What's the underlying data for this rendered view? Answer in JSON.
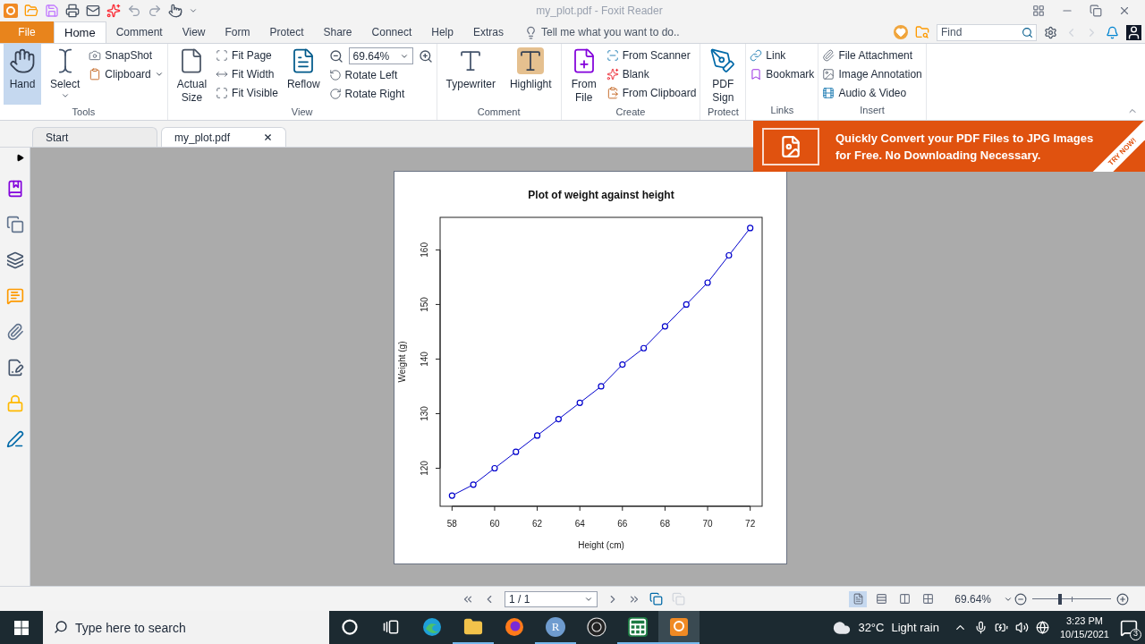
{
  "title_bar": {
    "title": "my_plot.pdf - Foxit Reader"
  },
  "ribbon_tabs": [
    {
      "label": "File",
      "kind": "file",
      "selected": false
    },
    {
      "label": "Home",
      "kind": "tab",
      "selected": true
    },
    {
      "label": "Comment",
      "kind": "tab",
      "selected": false
    },
    {
      "label": "View",
      "kind": "tab",
      "selected": false
    },
    {
      "label": "Form",
      "kind": "tab",
      "selected": false
    },
    {
      "label": "Protect",
      "kind": "tab",
      "selected": false
    },
    {
      "label": "Share",
      "kind": "tab",
      "selected": false
    },
    {
      "label": "Connect",
      "kind": "tab",
      "selected": false
    },
    {
      "label": "Help",
      "kind": "tab",
      "selected": false
    },
    {
      "label": "Extras",
      "kind": "tab",
      "selected": false
    }
  ],
  "tell_me": {
    "placeholder": "Tell me what you want to do.."
  },
  "find": {
    "placeholder": "Find"
  },
  "ribbon_groups": [
    {
      "label": "Tools",
      "columns": [
        {
          "kind": "large",
          "label": "Hand",
          "selected": true,
          "dropdown": false
        },
        {
          "kind": "large",
          "label": "Select",
          "selected": false,
          "dropdown": true
        },
        {
          "kind": "stack",
          "items": [
            {
              "kind": "small",
              "label": "SnapShot",
              "dropdown": false
            },
            {
              "kind": "small",
              "label": "Clipboard",
              "dropdown": true
            }
          ]
        }
      ]
    },
    {
      "label": "View",
      "columns": [
        {
          "kind": "large",
          "label": "Actual Size",
          "selected": false
        },
        {
          "kind": "stack",
          "items": [
            {
              "kind": "small",
              "label": "Fit Page",
              "dropdown": false
            },
            {
              "kind": "small",
              "label": "Fit Width",
              "dropdown": false
            },
            {
              "kind": "small",
              "label": "Fit Visible",
              "dropdown": false
            }
          ]
        },
        {
          "kind": "large",
          "label": "Reflow",
          "selected": false,
          "dropdown": false
        },
        {
          "kind": "stack",
          "items": [
            {
              "kind": "zoom",
              "value": "69.64%"
            },
            {
              "kind": "small",
              "label": "Rotate Left",
              "dropdown": false
            },
            {
              "kind": "small",
              "label": "Rotate Right",
              "dropdown": false
            }
          ]
        }
      ]
    },
    {
      "label": "Comment",
      "columns": [
        {
          "kind": "large",
          "label": "Typewriter",
          "selected": false,
          "dropdown": false
        },
        {
          "kind": "large",
          "label": "Highlight",
          "selected": false,
          "dropdown": false
        }
      ]
    },
    {
      "label": "Create",
      "columns": [
        {
          "kind": "large",
          "label": "From File",
          "selected": false
        },
        {
          "kind": "stack",
          "items": [
            {
              "kind": "small",
              "label": "From Scanner",
              "dropdown": false
            },
            {
              "kind": "small",
              "label": "Blank",
              "dropdown": false
            },
            {
              "kind": "small",
              "label": "From Clipboard",
              "dropdown": false
            }
          ]
        }
      ]
    },
    {
      "label": "Protect",
      "columns": [
        {
          "kind": "large",
          "label": "PDF Sign",
          "selected": false
        }
      ]
    },
    {
      "label": "Links",
      "columns": [
        {
          "kind": "stack",
          "items": [
            {
              "kind": "small",
              "label": "Link",
              "dropdown": false
            },
            {
              "kind": "small",
              "label": "Bookmark",
              "dropdown": false
            }
          ]
        }
      ]
    },
    {
      "label": "Insert",
      "columns": [
        {
          "kind": "stack",
          "items": [
            {
              "kind": "small",
              "label": "File Attachment",
              "dropdown": false
            },
            {
              "kind": "small",
              "label": "Image Annotation",
              "dropdown": false
            },
            {
              "kind": "small",
              "label": "Audio & Video",
              "dropdown": false
            }
          ]
        }
      ]
    }
  ],
  "doc_tabs": [
    {
      "label": "Start",
      "selected": false,
      "closable": false
    },
    {
      "label": "my_plot.pdf",
      "selected": true,
      "closable": true
    }
  ],
  "ad_banner": {
    "lines": [
      "Quickly Convert your PDF Files to JPG Images",
      "for Free. No Downloading Necessary."
    ],
    "corner": "TRY NOW!"
  },
  "document": {
    "chart_data": {
      "type": "line",
      "title": "Plot of weight against height",
      "xlabel": "Height (cm)",
      "ylabel": "Weight (g)",
      "x": [
        58,
        59,
        60,
        61,
        62,
        63,
        64,
        65,
        66,
        67,
        68,
        69,
        70,
        71,
        72
      ],
      "series": [
        {
          "color": "#0000cc",
          "marker": "circle",
          "values": [
            115,
            117,
            120,
            123,
            126,
            129,
            132,
            135,
            139,
            142,
            146,
            150,
            154,
            159,
            164
          ]
        }
      ],
      "xlim": [
        57.44,
        72.56
      ],
      "ylim": [
        113.04,
        165.96
      ],
      "xticks": [
        58,
        60,
        62,
        64,
        66,
        68,
        70,
        72
      ],
      "yticks": [
        120,
        130,
        140,
        150,
        160
      ]
    }
  },
  "status_bar": {
    "page_field": {
      "value": "1 / 1"
    },
    "view_modes": [
      {
        "selected": true
      },
      {
        "selected": false
      },
      {
        "selected": false
      },
      {
        "selected": false
      }
    ],
    "zoom": {
      "value": "69.64%",
      "level": 0.35
    }
  },
  "taskbar": {
    "search": {
      "placeholder": "Type here to search"
    },
    "apps": [
      {
        "running": false,
        "selected": false
      },
      {
        "running": false,
        "selected": false
      },
      {
        "running": false,
        "selected": false
      },
      {
        "running": true,
        "selected": false
      },
      {
        "running": false,
        "selected": false
      },
      {
        "label": "R",
        "running": true,
        "selected": false
      },
      {
        "running": false,
        "selected": false
      },
      {
        "running": true,
        "selected": false
      },
      {
        "running": true,
        "selected": true
      }
    ],
    "temperature": "32°C",
    "weather": "Light rain",
    "time": "3:23 PM",
    "date": "10/15/2021",
    "notifications": "3"
  }
}
